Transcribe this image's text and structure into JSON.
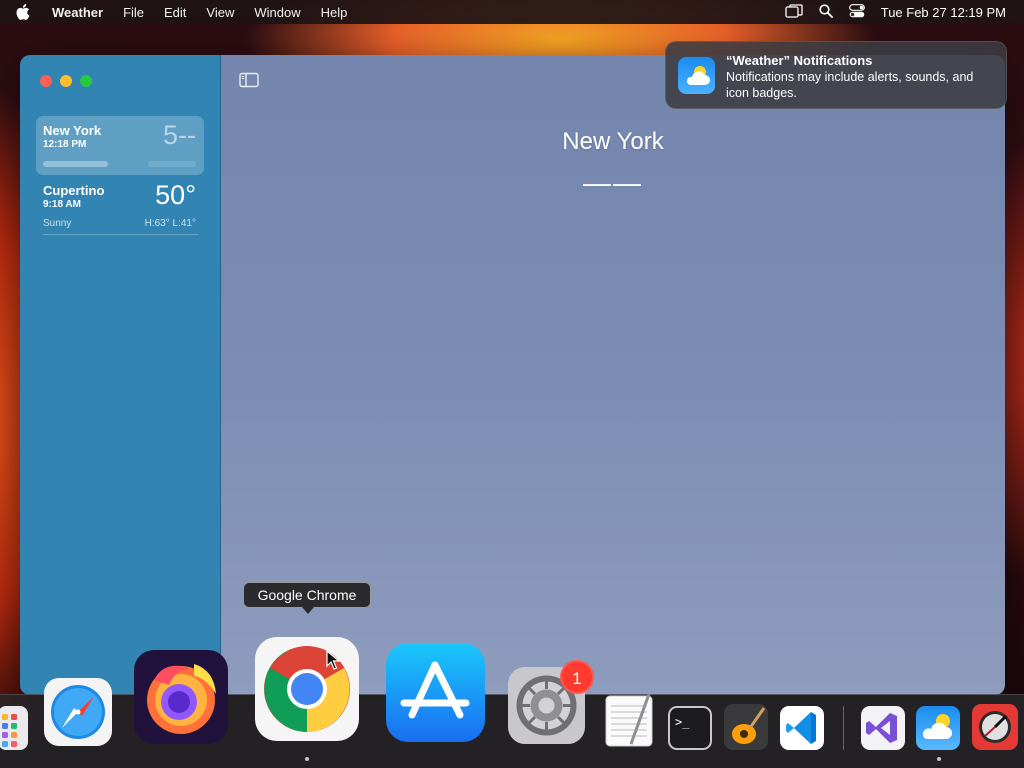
{
  "menubar": {
    "app_name": "Weather",
    "items": [
      "File",
      "Edit",
      "View",
      "Window",
      "Help"
    ],
    "clock": "Tue Feb 27  12:19 PM"
  },
  "sidebar": {
    "locations": [
      {
        "name": "New York",
        "time": "12:18 PM",
        "temp": "5--",
        "selected": true
      },
      {
        "name": "Cupertino",
        "time": "9:18 AM",
        "temp": "50°",
        "condition": "Sunny",
        "hilo": "H:63° L:41°",
        "selected": false
      }
    ]
  },
  "main": {
    "city": "New York",
    "temp": "——"
  },
  "notification": {
    "title": "“Weather” Notifications",
    "body": "Notifications may include alerts, sounds, and icon badges."
  },
  "tooltip": "Google Chrome",
  "dock": {
    "apps": [
      "Launchpad",
      "Safari",
      "Firefox",
      "Google Chrome",
      "App Store",
      "System Preferences",
      "TextEdit",
      "Terminal",
      "GarageBand",
      "Visual Studio Code",
      "Visual Studio",
      "Weather",
      "Instruments"
    ],
    "system_preferences_badge": "1"
  },
  "colors": {
    "sidebar": "#3284b2",
    "main_bg": "#7c8db4",
    "badge": "#ff3b30"
  }
}
